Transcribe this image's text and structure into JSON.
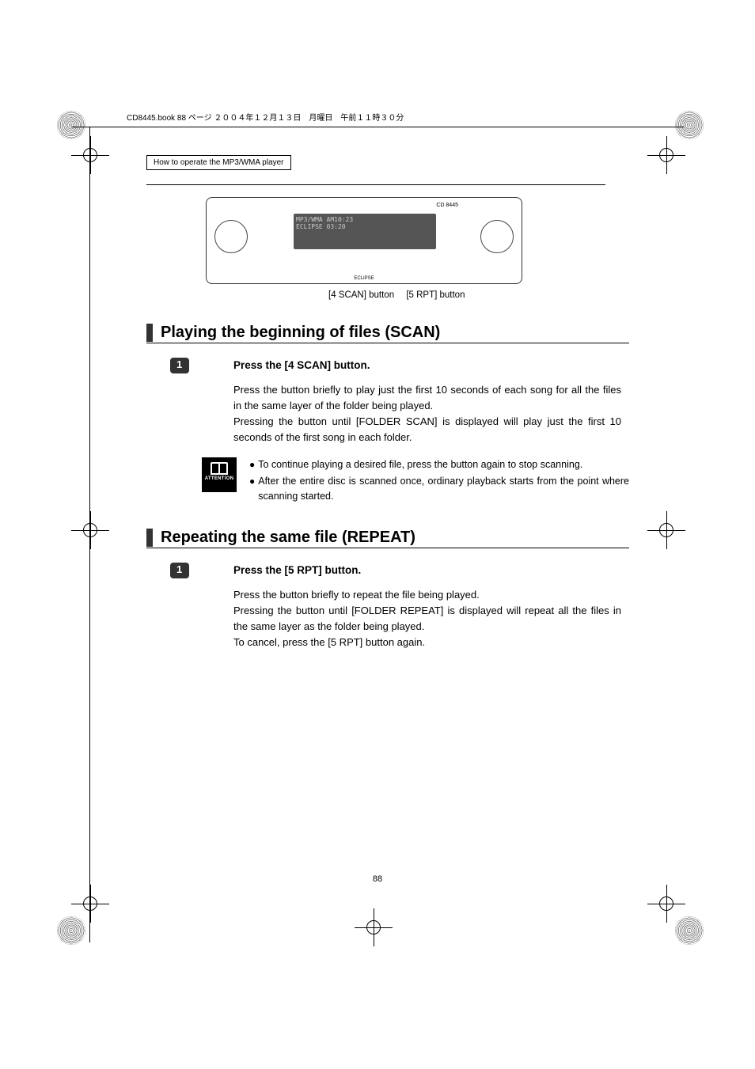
{
  "header_line": "CD8445.book  88 ページ  ２００４年１２月１３日　月曜日　午前１１時３０分",
  "section_header": "How to operate the MP3/WMA player",
  "radio": {
    "display_line1": "MP3/WMA    AM10:23",
    "display_line2": "ECLIPSE  03:20",
    "model": "CD 8445",
    "brand": "ECLIPSE"
  },
  "radio_labels": {
    "scan": "[4 SCAN] button",
    "rpt": "[5 RPT] button"
  },
  "section1": {
    "heading": "Playing the beginning of files (SCAN)",
    "step_num": "1",
    "step_title": "Press the [4 SCAN] button.",
    "body1": "Press the button briefly to play just the first 10 seconds of each song for all the files in the same layer of the folder being played.",
    "body2": "Pressing the button until [FOLDER SCAN] is displayed will play just the first 10 seconds of the first song in each folder.",
    "attention_label": "ATTENTION",
    "bullet1": "To continue playing a desired file, press the button again to stop scanning.",
    "bullet2": "After the entire disc is scanned once, ordinary playback starts from the point where scanning started."
  },
  "section2": {
    "heading": "Repeating the same file (REPEAT)",
    "step_num": "1",
    "step_title": "Press the [5 RPT] button.",
    "body1": "Press the button briefly to repeat the file being played.",
    "body2": "Pressing the button until [FOLDER REPEAT] is displayed will repeat all the files in the same layer as the folder being played.",
    "body3": "To cancel, press the [5 RPT] button again."
  },
  "page_number": "88"
}
